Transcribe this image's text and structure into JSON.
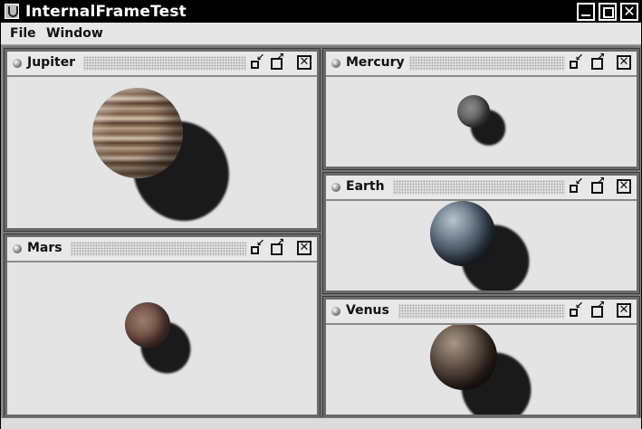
{
  "window": {
    "title": "InternalFrameTest"
  },
  "menu": {
    "items": [
      "File",
      "Window"
    ]
  },
  "frames": [
    {
      "id": "jupiter",
      "title": "Jupiter",
      "planet_color": "#8a6a52"
    },
    {
      "id": "mercury",
      "title": "Mercury",
      "planet_color": "#5a5a5a"
    },
    {
      "id": "earth",
      "title": "Earth",
      "planet_color": "#3a4a5a"
    },
    {
      "id": "mars",
      "title": "Mars",
      "planet_color": "#6a4a40"
    },
    {
      "id": "venus",
      "title": "Venus",
      "planet_color": "#4a3a30"
    }
  ]
}
